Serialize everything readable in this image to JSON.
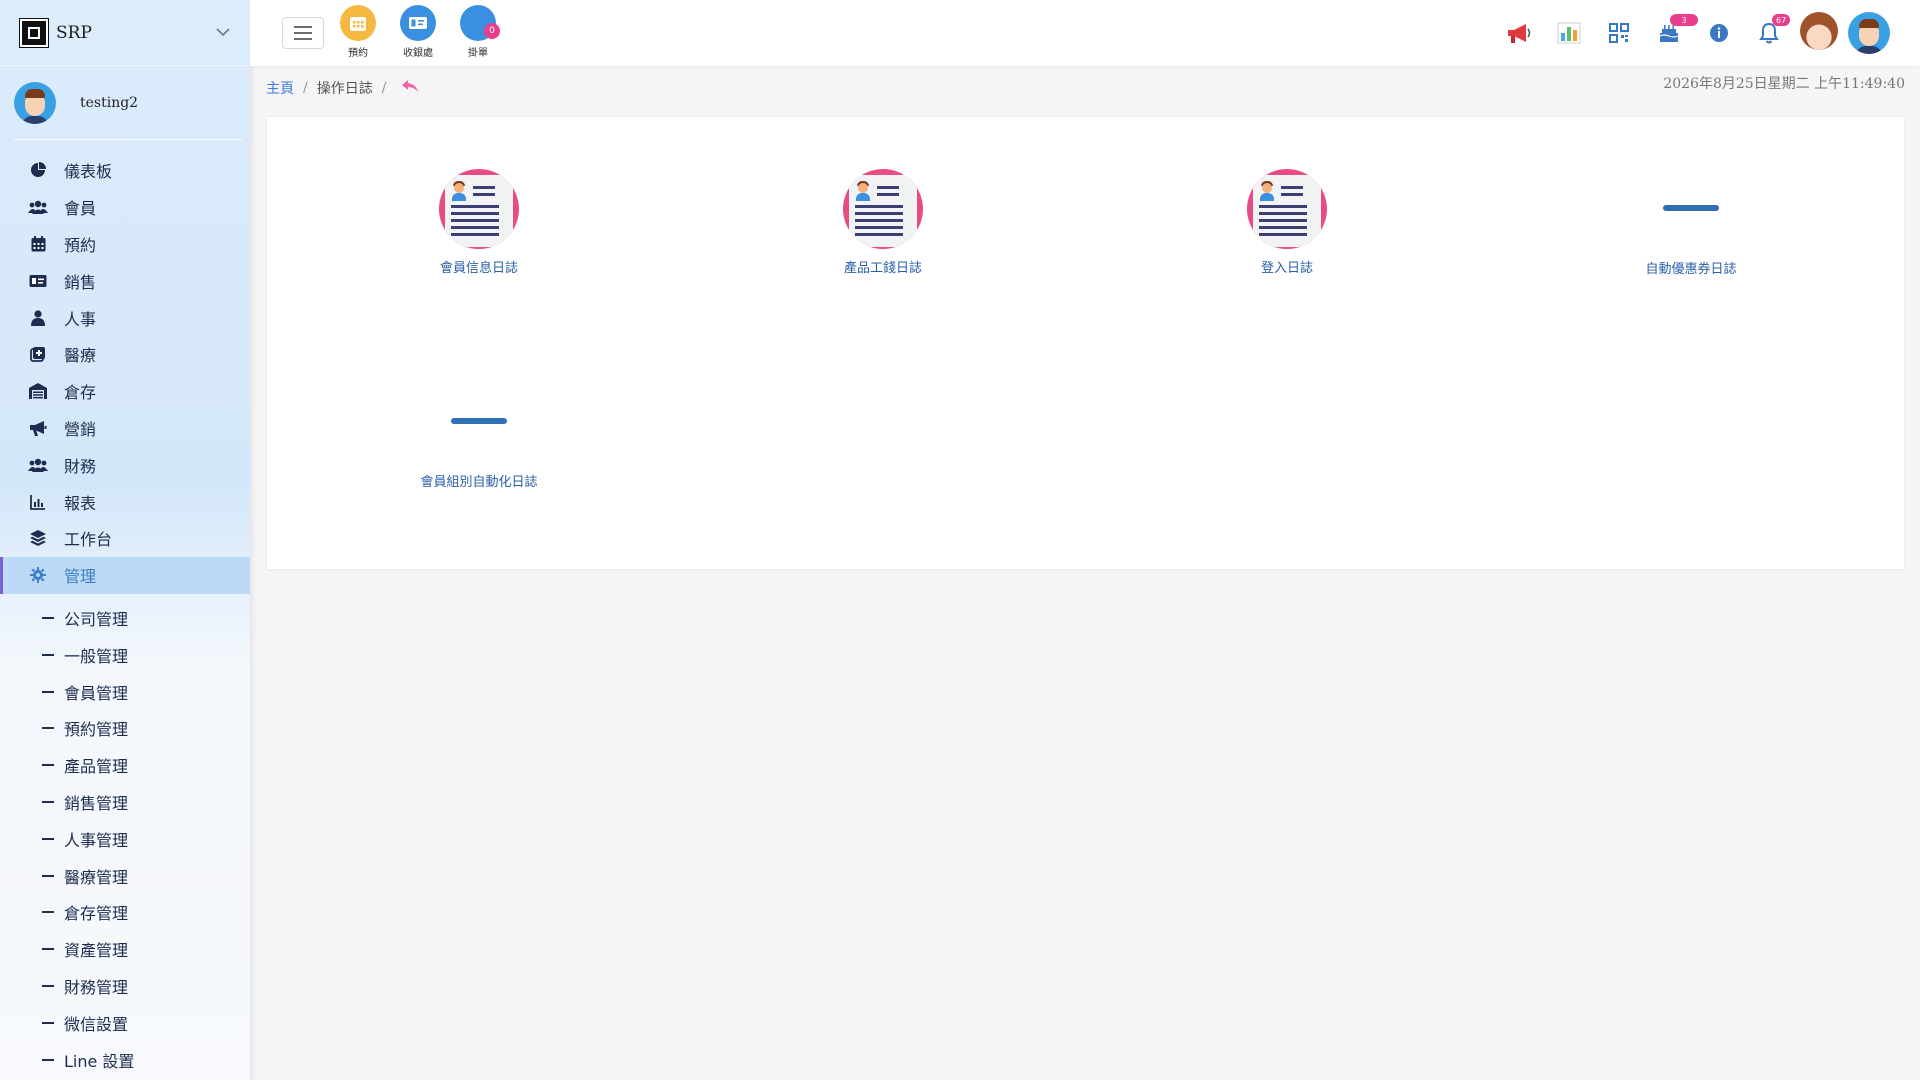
{
  "brand": {
    "name": "SRP"
  },
  "user": {
    "name": "testing2"
  },
  "sidebar": {
    "items": [
      {
        "label": "儀表板",
        "icon": "chart-pie-icon"
      },
      {
        "label": "會員",
        "icon": "users-icon"
      },
      {
        "label": "預約",
        "icon": "calendar-icon"
      },
      {
        "label": "銷售",
        "icon": "money-card-icon"
      },
      {
        "label": "人事",
        "icon": "person-icon"
      },
      {
        "label": "醫療",
        "icon": "medical-icon"
      },
      {
        "label": "倉存",
        "icon": "warehouse-icon"
      },
      {
        "label": "營銷",
        "icon": "megaphone-icon"
      },
      {
        "label": "財務",
        "icon": "users-money-icon"
      },
      {
        "label": "報表",
        "icon": "bar-chart-icon"
      },
      {
        "label": "工作台",
        "icon": "layers-icon"
      },
      {
        "label": "管理",
        "icon": "gear-icon",
        "active": true
      }
    ],
    "submenu": [
      "公司管理",
      "一般管理",
      "會員管理",
      "預約管理",
      "產品管理",
      "銷售管理",
      "人事管理",
      "醫療管理",
      "倉存管理",
      "資產管理",
      "財務管理",
      "微信設置",
      "Line 設置"
    ]
  },
  "topbar": {
    "quick": [
      {
        "label": "預約",
        "color": "#f5b942"
      },
      {
        "label": "收銀處",
        "color": "#3a8fe0"
      },
      {
        "label": "掛單",
        "color": "#3a8fe0",
        "badge": "0"
      }
    ],
    "badges": {
      "birthday": "3",
      "notifications": "67"
    }
  },
  "breadcrumb": {
    "home": "主頁",
    "current": "操作日誌"
  },
  "datetime": "2026年8月25日星期二 上午11:49:40",
  "tiles": [
    {
      "label": "會員信息日誌",
      "icon": "document-icon"
    },
    {
      "label": "產品工錢日誌",
      "icon": "document-icon"
    },
    {
      "label": "登入日誌",
      "icon": "document-icon"
    },
    {
      "label": "自動優惠券日誌",
      "icon": "dash-icon"
    },
    {
      "label": "會員組別自動化日誌",
      "icon": "dash-icon"
    }
  ]
}
